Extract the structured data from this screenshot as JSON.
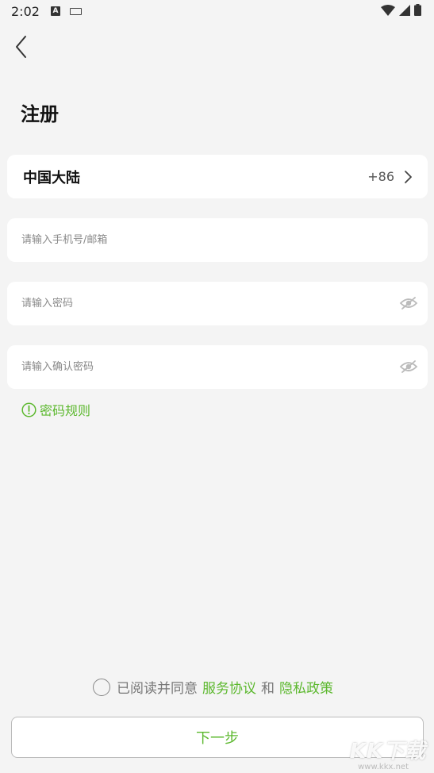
{
  "status_bar": {
    "time": "2:02",
    "a_icon_label": "A",
    "icons": [
      "a-icon",
      "keyboard-icon",
      "wifi-icon",
      "signal-icon",
      "battery-icon"
    ]
  },
  "header": {
    "back_icon": "chevron-left-icon",
    "title": "注册"
  },
  "region": {
    "name": "中国大陆",
    "code": "+86",
    "chevron_icon": "chevron-right-icon"
  },
  "form": {
    "phone_email": {
      "value": "",
      "placeholder": "请输入手机号/邮箱"
    },
    "password": {
      "value": "",
      "placeholder": "请输入密码",
      "toggle_icon": "eye-hidden-icon"
    },
    "confirm_password": {
      "value": "",
      "placeholder": "请输入确认密码",
      "toggle_icon": "eye-hidden-icon"
    }
  },
  "password_rule": {
    "label": "密码规则",
    "icon": "info-circle-icon"
  },
  "agreement": {
    "checked": false,
    "prefix": "已阅读并同意",
    "service_link": "服务协议",
    "conjunction": "和",
    "privacy_link": "隐私政策"
  },
  "next_button": {
    "label": "下一步"
  },
  "watermark": {
    "logo": "KK下载",
    "url": "www.kkx.net"
  },
  "colors": {
    "background": "#f4f4f4",
    "card": "#ffffff",
    "accent_green": "#5cb82e",
    "placeholder": "#8a8a8a"
  }
}
